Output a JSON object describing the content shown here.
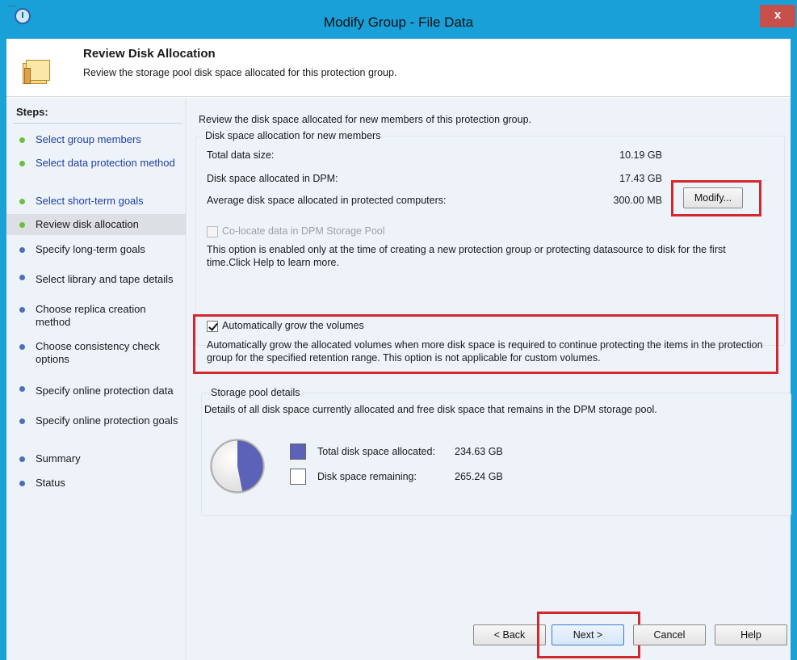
{
  "window": {
    "title": "Modify Group - File Data",
    "close_glyph": "x",
    "menu_dots": "..."
  },
  "header": {
    "title": "Review Disk Allocation",
    "subtitle": "Review the storage pool disk space allocated for this protection group.",
    "icon": "folder-icon"
  },
  "steps": {
    "title": "Steps:",
    "items": [
      {
        "label": "Select group members",
        "state": "done"
      },
      {
        "label": "Select data protection method",
        "state": "done"
      },
      {
        "label": "Select short-term goals",
        "state": "done"
      },
      {
        "label": "Review disk allocation",
        "state": "current"
      },
      {
        "label": "Specify long-term goals",
        "state": "todo"
      },
      {
        "label": "Select library and tape details",
        "state": "todo"
      },
      {
        "label": "Choose replica creation method",
        "state": "todo"
      },
      {
        "label": "Choose consistency check options",
        "state": "todo"
      },
      {
        "label": "Specify online protection data",
        "state": "todo"
      },
      {
        "label": "Specify online protection goals",
        "state": "todo"
      },
      {
        "label": "Summary",
        "state": "todo"
      },
      {
        "label": "Status",
        "state": "todo"
      }
    ]
  },
  "main": {
    "intro": "Review the disk space allocated for new members of this protection group.",
    "allocation": {
      "group_title": "Disk space allocation for new members",
      "rows": [
        {
          "label": "Total data size:",
          "value": "10.19 GB"
        },
        {
          "label": "Disk space allocated in DPM:",
          "value": "17.43 GB"
        },
        {
          "label": "Average disk space allocated in protected computers:",
          "value": "300.00 MB"
        }
      ],
      "modify_label": "Modify...",
      "colocate": {
        "label": "Co-locate data in DPM Storage Pool",
        "checked": false,
        "enabled": false,
        "description": "This option is enabled only at the time of creating a new protection group or protecting datasource to disk for the first time.Click Help to learn more."
      },
      "autogrow": {
        "label": "Automatically grow the volumes",
        "checked": true,
        "description": "Automatically grow the allocated volumes when more disk space is required to continue protecting the items in the protection group for the specified retention range. This option is not applicable for custom volumes."
      }
    },
    "storage_pool": {
      "group_title": "Storage pool details",
      "description": "Details of all disk space currently allocated and free disk space that remains in the DPM storage pool.",
      "legend": [
        {
          "label": "Total disk space allocated:",
          "value": "234.63 GB",
          "color": "#5b62b8"
        },
        {
          "label": "Disk space remaining:",
          "value": "265.24 GB",
          "color": "#ffffff"
        }
      ],
      "pie_allocated_fraction": 0.469
    }
  },
  "buttons": {
    "back": "< Back",
    "next": "Next >",
    "cancel": "Cancel",
    "help": "Help"
  },
  "colors": {
    "titlebar": "#19a0d8",
    "highlight_red": "#d3282e",
    "panel_bg": "#eef3fa",
    "pie_allocated": "#5b62b8"
  }
}
